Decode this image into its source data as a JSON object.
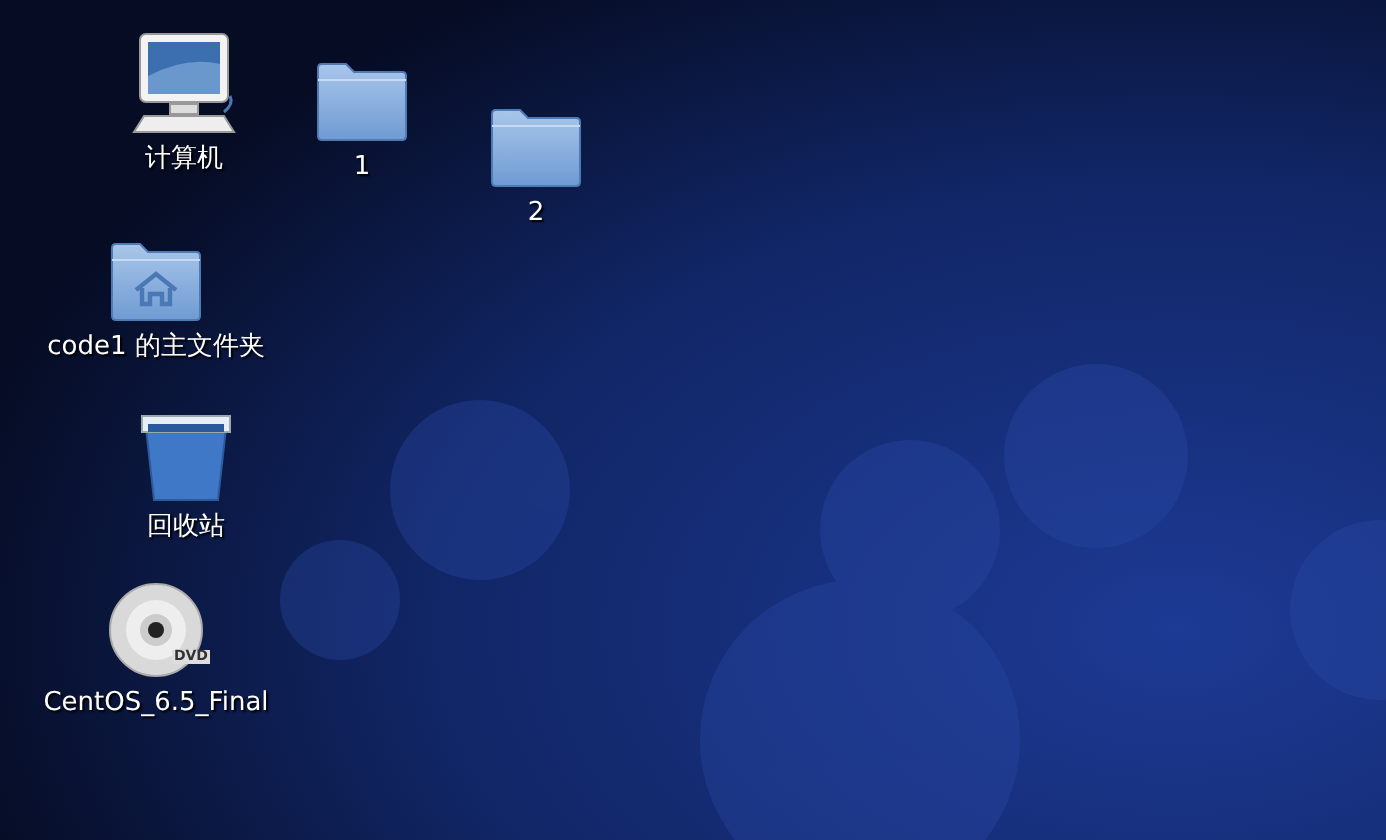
{
  "desktop_icons": [
    {
      "kind": "computer",
      "label": "计算机"
    },
    {
      "kind": "folder",
      "label": "1"
    },
    {
      "kind": "folder",
      "label": "2"
    },
    {
      "kind": "home",
      "label": "code1 的主文件夹"
    },
    {
      "kind": "trash",
      "label": "回收站"
    },
    {
      "kind": "dvd",
      "label": "CentOS_6.5_Final",
      "badge": "DVD"
    }
  ]
}
